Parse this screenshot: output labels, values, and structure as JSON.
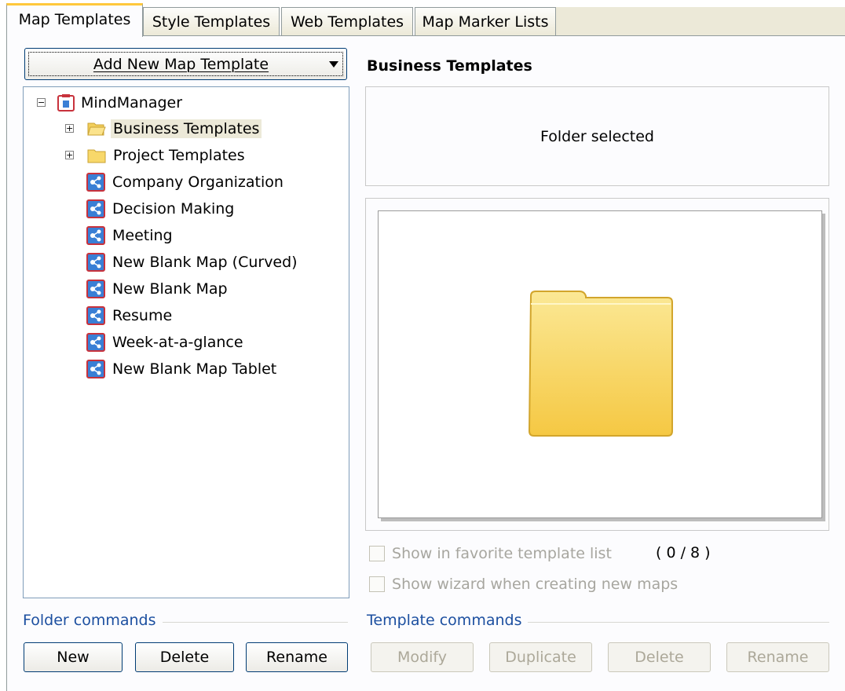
{
  "tabs": [
    {
      "label": "Map Templates",
      "active": true
    },
    {
      "label": "Style Templates",
      "active": false
    },
    {
      "label": "Web Templates",
      "active": false
    },
    {
      "label": "Map Marker Lists",
      "active": false
    }
  ],
  "add_template_button": {
    "label": "Add New Map Template"
  },
  "tree": {
    "root": {
      "label": "MindManager",
      "icon": "mindmanager-root-icon",
      "expanded": true
    },
    "folders": [
      {
        "label": "Business Templates",
        "icon": "folder-open-icon",
        "selected": true
      },
      {
        "label": "Project Templates",
        "icon": "folder-icon",
        "selected": false
      }
    ],
    "templates": [
      {
        "label": "Company Organization"
      },
      {
        "label": "Decision Making"
      },
      {
        "label": "Meeting"
      },
      {
        "label": "New Blank Map (Curved)"
      },
      {
        "label": "New Blank Map"
      },
      {
        "label": "Resume"
      },
      {
        "label": "Week-at-a-glance"
      },
      {
        "label": "New Blank Map Tablet"
      }
    ]
  },
  "detail": {
    "title": "Business Templates",
    "info_text": "Folder selected",
    "preview_icon": "large-folder-icon",
    "favorite_checkbox": {
      "label": "Show in favorite template list",
      "checked": false,
      "enabled": false
    },
    "favorite_count": "( 0 / 8 )",
    "wizard_checkbox": {
      "label": "Show wizard when creating new maps",
      "checked": false,
      "enabled": false
    }
  },
  "folder_commands": {
    "label": "Folder commands",
    "buttons": [
      "New",
      "Delete",
      "Rename"
    ]
  },
  "template_commands": {
    "label": "Template commands",
    "buttons": [
      "Modify",
      "Duplicate",
      "Delete",
      "Rename"
    ]
  },
  "colors": {
    "tab_active_accent": "#ffc83c",
    "group_label": "#1c4fa0",
    "folder_yellow": "#f8d86a",
    "template_icon_blue": "#3a7fd5"
  }
}
